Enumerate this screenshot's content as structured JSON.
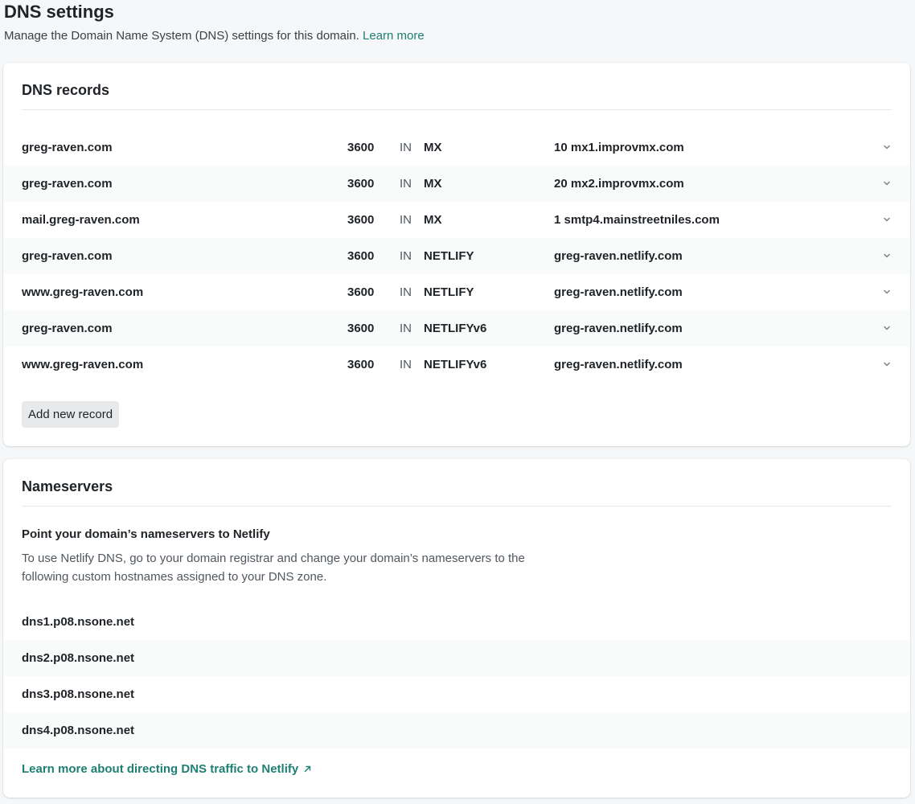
{
  "page": {
    "title": "DNS settings",
    "description": "Manage the Domain Name System (DNS) settings for this domain.",
    "learn_more": "Learn more"
  },
  "records_card": {
    "title": "DNS records",
    "records": [
      {
        "host": "greg-raven.com",
        "ttl": "3600",
        "class": "IN",
        "type": "MX",
        "value": "10 mx1.improvmx.com"
      },
      {
        "host": "greg-raven.com",
        "ttl": "3600",
        "class": "IN",
        "type": "MX",
        "value": "20 mx2.improvmx.com"
      },
      {
        "host": "mail.greg-raven.com",
        "ttl": "3600",
        "class": "IN",
        "type": "MX",
        "value": "1 smtp4.mainstreetniles.com"
      },
      {
        "host": "greg-raven.com",
        "ttl": "3600",
        "class": "IN",
        "type": "NETLIFY",
        "value": "greg-raven.netlify.com"
      },
      {
        "host": "www.greg-raven.com",
        "ttl": "3600",
        "class": "IN",
        "type": "NETLIFY",
        "value": "greg-raven.netlify.com"
      },
      {
        "host": "greg-raven.com",
        "ttl": "3600",
        "class": "IN",
        "type": "NETLIFYv6",
        "value": "greg-raven.netlify.com"
      },
      {
        "host": "www.greg-raven.com",
        "ttl": "3600",
        "class": "IN",
        "type": "NETLIFYv6",
        "value": "greg-raven.netlify.com"
      }
    ],
    "add_button": "Add new record"
  },
  "nameservers_card": {
    "title": "Nameservers",
    "subtitle": "Point your domain’s nameservers to Netlify",
    "description": "To use Netlify DNS, go to your domain registrar and change your domain’s nameservers to the following custom hostnames assigned to your DNS zone.",
    "nameservers": [
      "dns1.p08.nsone.net",
      "dns2.p08.nsone.net",
      "dns3.p08.nsone.net",
      "dns4.p08.nsone.net"
    ],
    "footer_link": "Learn more about directing DNS traffic to Netlify"
  },
  "colors": {
    "accent": "#1d7f73",
    "background": "#f5f7f8",
    "card": "#ffffff",
    "stripe": "#f9fafa"
  },
  "icons": {
    "row_toggle": "chevron-down-icon",
    "external_link": "arrow-up-right-icon"
  }
}
